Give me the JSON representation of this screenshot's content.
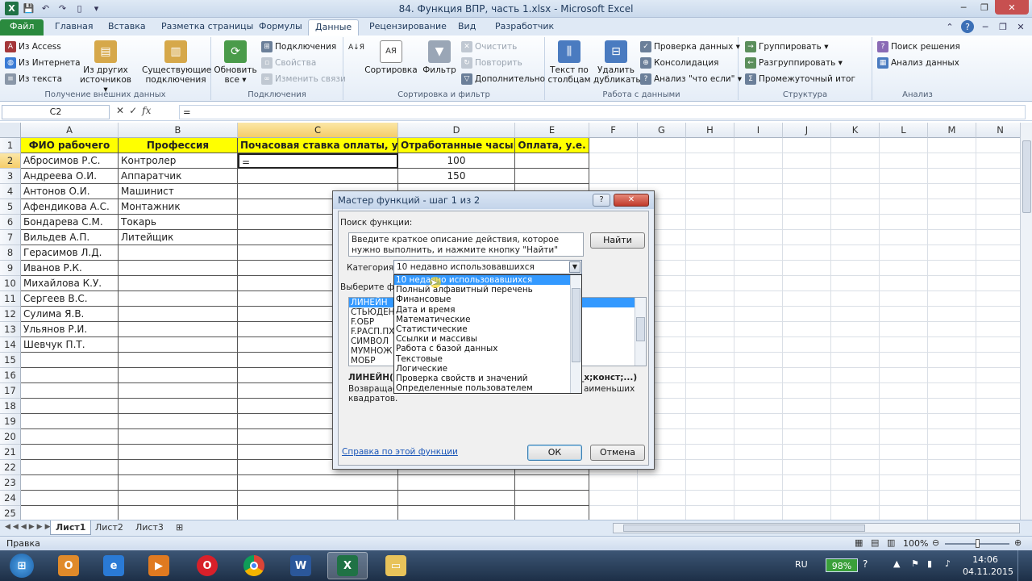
{
  "window": {
    "title": "84. Функция ВПР, часть 1.xlsx  -  Microsoft Excel"
  },
  "ribbon_tabs": [
    {
      "label": "Файл"
    },
    {
      "label": "Главная"
    },
    {
      "label": "Вставка"
    },
    {
      "label": "Разметка страницы"
    },
    {
      "label": "Формулы"
    },
    {
      "label": "Данные"
    },
    {
      "label": "Рецензирование"
    },
    {
      "label": "Вид"
    },
    {
      "label": "Разработчик"
    }
  ],
  "ribbon": {
    "external": {
      "access": "Из Access",
      "web": "Из Интернета",
      "text": "Из текста",
      "other1": "Из других",
      "other2": "источников ▾",
      "existing1": "Существующие",
      "existing2": "подключения",
      "label": "Получение внешних данных"
    },
    "connections": {
      "refresh1": "Обновить",
      "refresh2": "все ▾",
      "conn": "Подключения",
      "props": "Свойства",
      "edit": "Изменить связи",
      "label": "Подключения"
    },
    "sort": {
      "sort": "Сортировка",
      "filter": "Фильтр",
      "clear": "Очистить",
      "reapply": "Повторить",
      "advanced": "Дополнительно",
      "az": "А↓Я",
      "label": "Сортировка и фильтр"
    },
    "tools": {
      "t2c1": "Текст по",
      "t2c2": "столбцам",
      "dup1": "Удалить",
      "dup2": "дубликаты",
      "validate": "Проверка данных ▾",
      "consolidate": "Консолидация",
      "whatif": "Анализ \"что если\" ▾",
      "label": "Работа с данными"
    },
    "outline": {
      "group": "Группировать ▾",
      "ungroup": "Разгруппировать ▾",
      "subtotal": "Промежуточный итог",
      "label": "Структура"
    },
    "analysis": {
      "solver": "Поиск решения",
      "analysis": "Анализ данных",
      "label": "Анализ"
    }
  },
  "formula_bar": {
    "name_box": "C2",
    "formula": "="
  },
  "columns": [
    "A",
    "B",
    "C",
    "D",
    "E",
    "F",
    "G",
    "H",
    "I",
    "J",
    "K",
    "L",
    "M",
    "N"
  ],
  "rows": [
    "1",
    "2",
    "3",
    "4",
    "5",
    "6",
    "7",
    "8",
    "9",
    "10",
    "11",
    "12",
    "13",
    "14",
    "15",
    "16",
    "17",
    "18",
    "19",
    "20",
    "21",
    "22",
    "23",
    "24",
    "25"
  ],
  "table": {
    "headers": [
      "ФИО рабочего",
      "Профессия",
      "Почасовая ставка оплаты, у.е.",
      "Отработанные часы",
      "Оплата, у.е."
    ],
    "rows": [
      [
        "Абросимов Р.С.",
        "Контролер",
        "=",
        "100",
        ""
      ],
      [
        "Андреева О.И.",
        "Аппаратчик",
        "",
        "150",
        ""
      ],
      [
        "Антонов О.И.",
        "Машинист",
        "",
        "",
        ""
      ],
      [
        "Афендикова А.С.",
        "Монтажник",
        "",
        "",
        ""
      ],
      [
        "Бондарева С.М.",
        "Токарь",
        "",
        "",
        ""
      ],
      [
        "Вильдев А.П.",
        "Литейщик",
        "",
        "",
        ""
      ],
      [
        "Герасимов Л.Д.",
        "",
        "",
        "",
        ""
      ],
      [
        "Иванов Р.К.",
        "",
        "",
        "",
        ""
      ],
      [
        "Михайлова К.У.",
        "",
        "",
        "",
        ""
      ],
      [
        "Сергеев В.С.",
        "",
        "",
        "",
        ""
      ],
      [
        "Сулима Я.В.",
        "",
        "",
        "",
        ""
      ],
      [
        "Ульянов Р.И.",
        "",
        "",
        "",
        ""
      ],
      [
        "Шевчук П.Т.",
        "",
        "",
        "",
        ""
      ]
    ]
  },
  "sheet_tabs": [
    {
      "label": "Лист1"
    },
    {
      "label": "Лист2"
    },
    {
      "label": "Лист3"
    }
  ],
  "status": {
    "mode": "Правка",
    "zoom": "100%"
  },
  "taskbar": {
    "lang": "RU",
    "battery": "98%",
    "time": "14:06",
    "date": "04.11.2015"
  },
  "dialog": {
    "title": "Мастер функций - шаг 1 из 2",
    "search_label": "Поиск функции:",
    "search_text": "Введите краткое описание действия, которое нужно выполнить, и нажмите кнопку \"Найти\"",
    "find_button": "Найти",
    "category_label": "Категория:",
    "category_value": "10 недавно использовавшихся",
    "select_label": "Выберите функ",
    "functions": [
      "ЛИНЕЙН",
      "СТЬЮДЕНТ",
      "F.ОБР",
      "F.РАСП.ПХ",
      "СИМВОЛ",
      "МУМНОЖ",
      "МОБР"
    ],
    "signature_left": "ЛИНЕЙН(из",
    "signature_right": "а_х;конст;...)",
    "desc_left": "Возвращает",
    "desc_right": "аименьших",
    "desc_line2": "квадратов.",
    "help_link": "Справка по этой функции",
    "ok": "ОК",
    "cancel": "Отмена"
  },
  "category_dropdown": [
    "10 недавно использовавшихся",
    "Полный алфавитный перечень",
    "Финансовые",
    "Дата и время",
    "Математические",
    "Статистические",
    "Ссылки и массивы",
    "Работа с базой данных",
    "Текстовые",
    "Логические",
    "Проверка свойств и значений",
    "Определенные пользователем"
  ]
}
